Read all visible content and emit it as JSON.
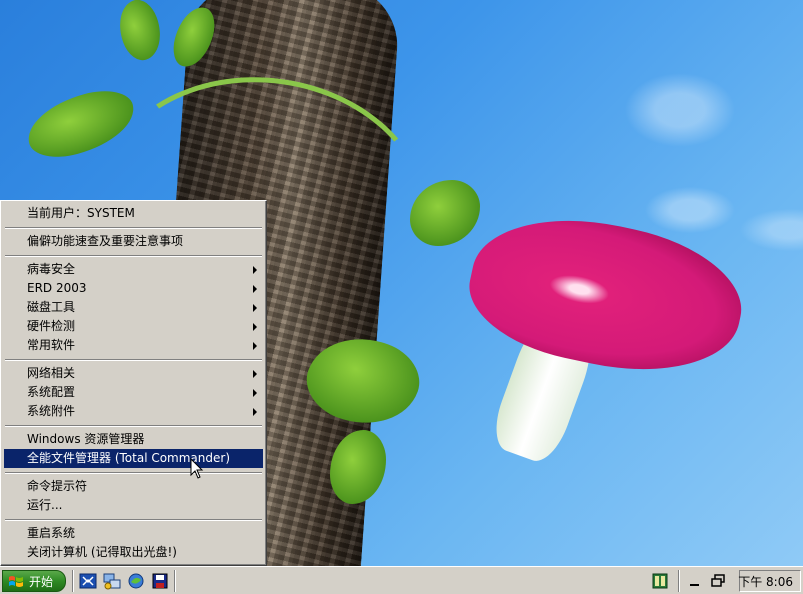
{
  "start_menu": {
    "current_user": "当前用户：SYSTEM",
    "items": [
      {
        "label": "偏僻功能速查及重要注意事项"
      },
      {
        "label": "病毒安全"
      },
      {
        "label": "ERD 2003"
      },
      {
        "label": "磁盘工具"
      },
      {
        "label": "硬件检测"
      },
      {
        "label": "常用软件"
      },
      {
        "label": "网络相关"
      },
      {
        "label": "系统配置"
      },
      {
        "label": "系统附件"
      },
      {
        "label": "Windows 资源管理器"
      },
      {
        "label": "全能文件管理器 (Total Commander)"
      },
      {
        "label": "命令提示符"
      },
      {
        "label": "运行..."
      },
      {
        "label": "重启系统"
      },
      {
        "label": "关闭计算机 (记得取出光盘!)"
      }
    ],
    "highlight_color": "#0a246a"
  },
  "taskbar": {
    "start_label": "开始",
    "quick_launch": [
      "show-desktop-icon",
      "network-icon",
      "browser-icon",
      "save-icon"
    ],
    "tray_icons": [
      "book-icon",
      "minimize-icon",
      "restore-icon"
    ],
    "clock": "下午 8:06"
  }
}
